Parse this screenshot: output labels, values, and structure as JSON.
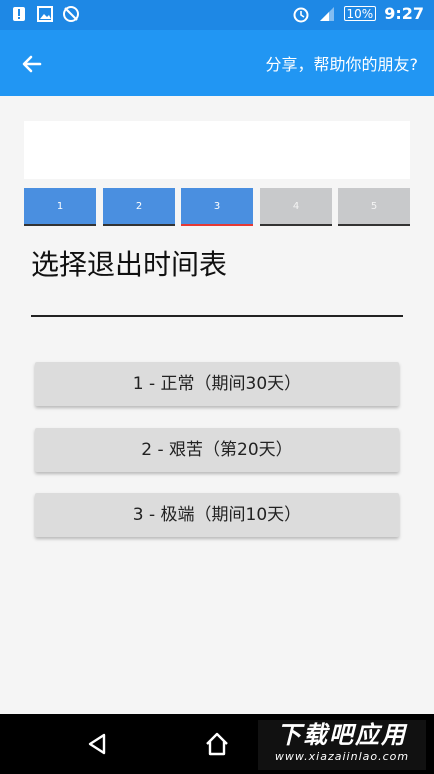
{
  "status_bar": {
    "icons": [
      "alert-icon",
      "image-icon",
      "no-sync-icon",
      "alarm-icon",
      "signal-icon"
    ],
    "battery": "10%",
    "time": "9:27"
  },
  "app_bar": {
    "share_label": "分享，帮助你的朋友?"
  },
  "steps": [
    {
      "label": "1",
      "state": "done"
    },
    {
      "label": "2",
      "state": "done"
    },
    {
      "label": "3",
      "state": "active"
    },
    {
      "label": "4",
      "state": "todo"
    },
    {
      "label": "5",
      "state": "todo"
    }
  ],
  "main": {
    "title": "选择退出时间表",
    "options": [
      "1 - 正常（期间30天）",
      "2 - 艰苦（第20天）",
      "3 - 极端（期间10天）"
    ]
  },
  "watermark": {
    "big": "下载吧应用",
    "small": "www.xiazaiinlao.com"
  },
  "colors": {
    "status_bar": "#1e88e5",
    "app_bar": "#2196f3",
    "step_done": "#4a8fe0",
    "step_todo": "#c8c9cb",
    "step_active_underline": "#e53935"
  }
}
